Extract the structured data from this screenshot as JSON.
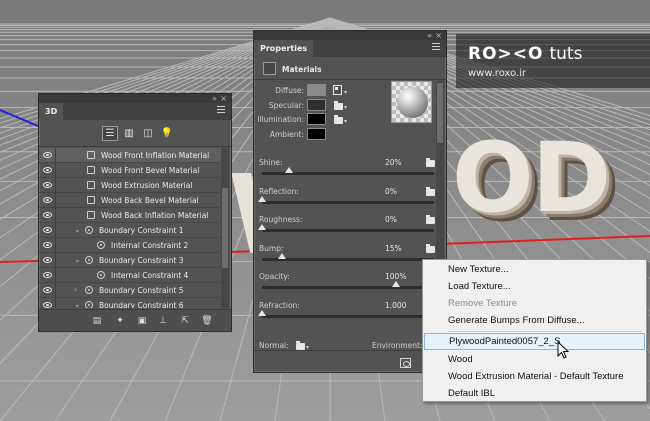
{
  "watermark": {
    "brand_bold": "RO><O",
    "brand_thin": "tuts",
    "url": "www.roxo.ir"
  },
  "scene": {
    "letters_visible": "OD"
  },
  "panel3d": {
    "title": "3D",
    "rows": [
      {
        "label": "Wood Front Inflation Material",
        "type": "material",
        "indent": 1,
        "expander": "",
        "selected": true
      },
      {
        "label": "Wood Front Bevel Material",
        "type": "material",
        "indent": 1,
        "expander": "",
        "selected": false
      },
      {
        "label": "Wood Extrusion Material",
        "type": "material",
        "indent": 1,
        "expander": "",
        "selected": false
      },
      {
        "label": "Wood Back Bevel Material",
        "type": "material",
        "indent": 1,
        "expander": "",
        "selected": false
      },
      {
        "label": "Wood Back Inflation Material",
        "type": "material",
        "indent": 1,
        "expander": "",
        "selected": false
      },
      {
        "label": "Boundary Constraint 1",
        "type": "constraint",
        "indent": 0,
        "expander": "v",
        "selected": false
      },
      {
        "label": "Internal Constraint 2",
        "type": "constraint",
        "indent": 1,
        "expander": "",
        "selected": false
      },
      {
        "label": "Boundary Constraint 3",
        "type": "constraint",
        "indent": 0,
        "expander": "v",
        "selected": false
      },
      {
        "label": "Internal Constraint 4",
        "type": "constraint",
        "indent": 1,
        "expander": "",
        "selected": false
      },
      {
        "label": "Boundary Constraint 5",
        "type": "constraint",
        "indent": 0,
        "expander": ">",
        "selected": false
      },
      {
        "label": "Boundary Constraint 6",
        "type": "constraint",
        "indent": 0,
        "expander": "v",
        "selected": false
      }
    ]
  },
  "properties": {
    "title": "Properties",
    "section": "Materials",
    "diffuse_label": "Diffuse:",
    "specular_label": "Specular:",
    "illumination_label": "Illumination:",
    "ambient_label": "Ambient:",
    "colors": {
      "diffuse": "#8b8b8b",
      "specular": "#2e2e2e",
      "illumination": "#000000",
      "ambient": "#000000"
    },
    "sliders": [
      {
        "label": "Shine:",
        "value": "20%",
        "level": 0.2
      },
      {
        "label": "Reflection:",
        "value": "0%",
        "level": 0.0
      },
      {
        "label": "Roughness:",
        "value": "0%",
        "level": 0.0
      },
      {
        "label": "Bump:",
        "value": "15%",
        "level": 0.15
      },
      {
        "label": "Opacity:",
        "value": "100%",
        "level": 1.0
      },
      {
        "label": "Refraction:",
        "value": "1.000",
        "level": 0.0
      }
    ],
    "normal_label": "Normal:",
    "environment_label": "Environment:"
  },
  "context_menu": {
    "items": [
      {
        "label": "New Texture...",
        "disabled": false
      },
      {
        "label": "Load Texture...",
        "disabled": false
      },
      {
        "label": "Remove Texture",
        "disabled": true
      },
      {
        "label": "Generate Bumps From Diffuse...",
        "disabled": false
      },
      {
        "label": "PlywoodPainted0057_2_S",
        "disabled": false,
        "hover": true
      },
      {
        "label": "Wood",
        "disabled": false
      },
      {
        "label": "Wood Extrusion Material - Default Texture",
        "disabled": false
      },
      {
        "label": "Default IBL",
        "disabled": false
      }
    ]
  },
  "accent_colors": {
    "axis_x": "#e02020",
    "axis_z": "#2020e0",
    "menu_hover": "#e5f1fb"
  }
}
